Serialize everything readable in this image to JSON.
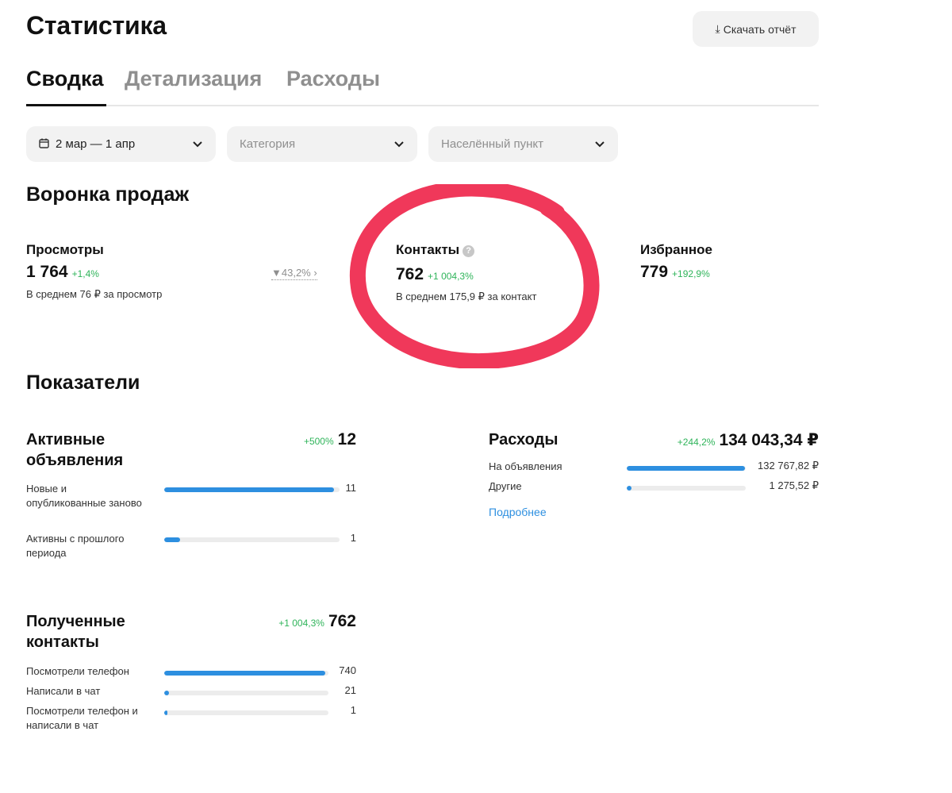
{
  "header": {
    "title": "Статистика",
    "download_label": "Скачать отчёт",
    "download_icon": "download-icon"
  },
  "tabs": [
    {
      "label": "Сводка",
      "active": true
    },
    {
      "label": "Детализация",
      "active": false
    },
    {
      "label": "Расходы",
      "active": false
    }
  ],
  "filters": {
    "period": {
      "value": "2 мар — 1 апр",
      "icon": "calendar-icon"
    },
    "category": {
      "placeholder": "Категория"
    },
    "city": {
      "placeholder": "Населённый пункт"
    }
  },
  "funnel": {
    "title": "Воронка продаж",
    "views": {
      "label": "Просмотры",
      "value": "1 764",
      "delta": "+1,4%",
      "sub": "В среднем 76 ₽ за просмотр"
    },
    "conversion": {
      "text": "▼43,2% ›"
    },
    "contacts": {
      "label": "Контакты",
      "value": "762",
      "delta": "+1 004,3%",
      "sub": "В среднем 175,9 ₽ за контакт"
    },
    "favorites": {
      "label": "Избранное",
      "value": "779",
      "delta": "+192,9%"
    }
  },
  "metrics": {
    "title": "Показатели",
    "active_ads": {
      "title": "Активные объявления",
      "delta": "+500%",
      "total": "12",
      "rows": [
        {
          "label": "Новые и опубликованные заново",
          "value": "11",
          "fraction": 0.97
        },
        {
          "label": "Активны с прошлого периода",
          "value": "1",
          "fraction": 0.09
        }
      ]
    },
    "expenses": {
      "title": "Расходы",
      "delta": "+244,2%",
      "total": "134 043,34 ₽",
      "rows": [
        {
          "label": "На объявления",
          "value": "132 767,82 ₽",
          "fraction": 0.99
        },
        {
          "label": "Другие",
          "value": "1 275,52 ₽",
          "fraction": 0.04
        }
      ],
      "link": "Подробнее"
    },
    "contacts": {
      "title": "Полученные контакты",
      "delta": "+1 004,3%",
      "total": "762",
      "rows": [
        {
          "label": "Посмотрели телефон",
          "value": "740",
          "fraction": 0.98
        },
        {
          "label": "Написали в чат",
          "value": "21",
          "fraction": 0.03
        },
        {
          "label": "Посмотрели телефон и написали в чат",
          "value": "1",
          "fraction": 0.02
        }
      ]
    }
  },
  "colors": {
    "accent_blue": "#2d8fe0",
    "positive_green": "#2fb45a",
    "annotation_red": "#f0385a"
  }
}
